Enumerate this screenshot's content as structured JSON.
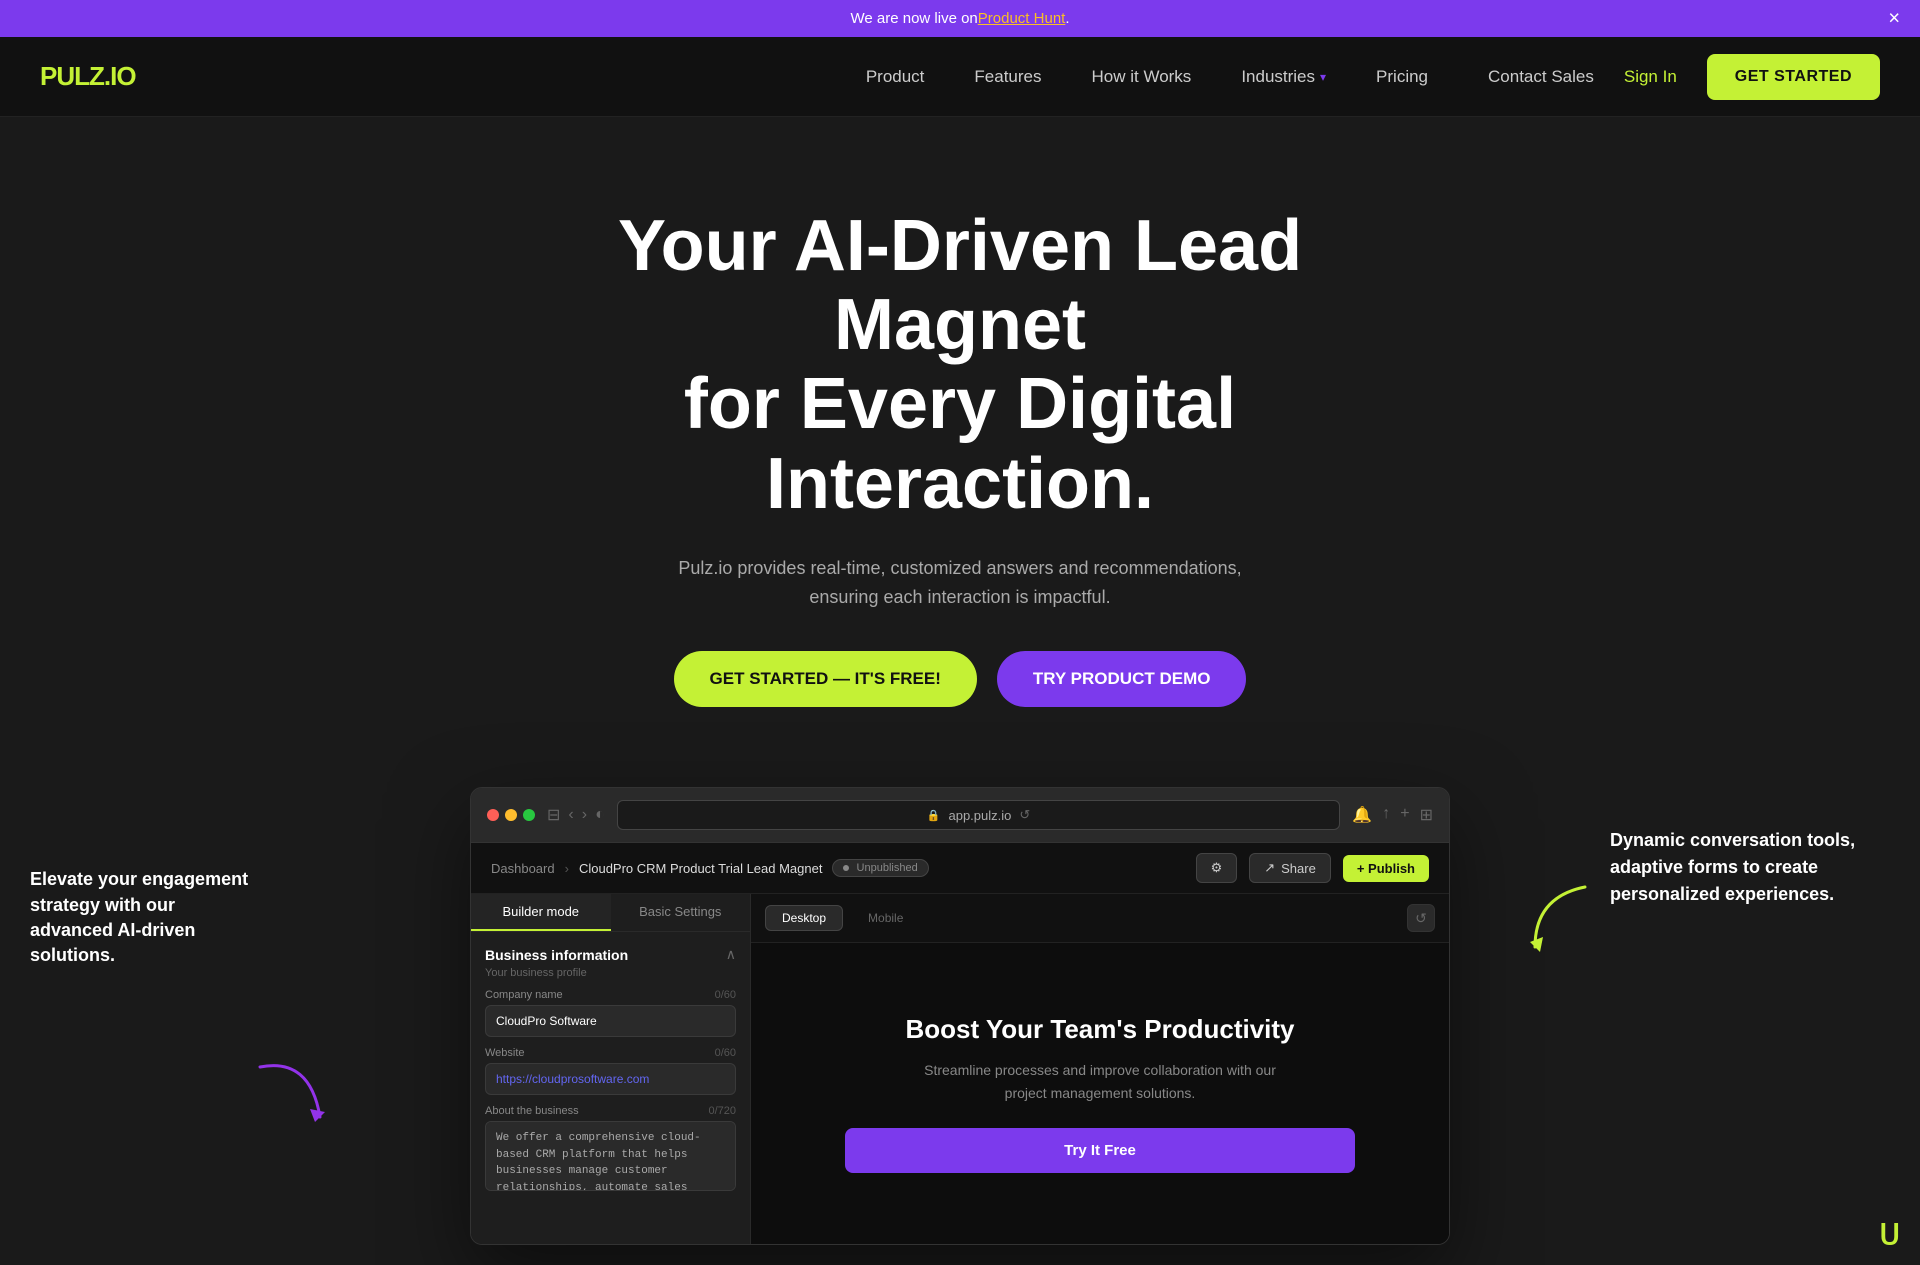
{
  "banner": {
    "text": "We are now live on ",
    "link_text": "Product Hunt",
    "link_url": "#",
    "close_label": "×"
  },
  "navbar": {
    "logo_text": "PULZ",
    "logo_dot": ".",
    "logo_io": "IO",
    "nav_items": [
      {
        "label": "Product",
        "has_dropdown": false
      },
      {
        "label": "Features",
        "has_dropdown": false
      },
      {
        "label": "How it Works",
        "has_dropdown": false
      },
      {
        "label": "Industries",
        "has_dropdown": true
      },
      {
        "label": "Pricing",
        "has_dropdown": false
      }
    ],
    "contact_sales": "Contact Sales",
    "sign_in": "Sign In",
    "get_started": "GET STARTED"
  },
  "hero": {
    "title_line1": "Your AI-Driven Lead Magnet",
    "title_line2": "for Every Digital Interaction.",
    "subtitle": "Pulz.io provides real-time, customized answers and recommendations, ensuring each interaction is impactful.",
    "cta_primary": "GET STARTED — IT'S FREE!",
    "cta_secondary": "TRY PRODUCT DEMO"
  },
  "left_callout": {
    "text": "Elevate your engagement strategy with our advanced AI-driven solutions."
  },
  "right_callout": {
    "text": "Dynamic conversation tools, adaptive forms to create personalized experiences."
  },
  "browser": {
    "address": "app.pulz.io",
    "breadcrumb_home": "Dashboard",
    "breadcrumb_page": "CloudPro CRM Product Trial Lead Magnet",
    "status": "Unpublished",
    "share_label": "Share",
    "publish_label": "+ Publish"
  },
  "left_panel": {
    "tab_builder": "Builder mode",
    "tab_settings": "Basic Settings",
    "section_title": "Business information",
    "section_subtitle": "Your business profile",
    "company_label": "Company name",
    "company_count": "0/60",
    "company_value": "CloudPro Software",
    "website_label": "Website",
    "website_count": "0/60",
    "website_value": "https://cloudprosoftware.com",
    "about_label": "About the business",
    "about_count": "0/720",
    "about_value": "We offer a comprehensive cloud-based CRM platform that helps businesses manage customer relationships, automate sales processes, and analyze customer data for improved decision-making."
  },
  "preview": {
    "desktop_label": "Desktop",
    "mobile_label": "Mobile",
    "title": "Boost Your Team's Productivity",
    "description": "Streamline processes and improve collaboration with our project management solutions.",
    "cta_label": "Try It Free"
  },
  "icons": {
    "close": "×",
    "back": "‹",
    "forward": "›",
    "lock": "🔒",
    "refresh": "↺",
    "download": "↓",
    "share": "↑",
    "add": "+",
    "grid": "⊞",
    "bell": "🔔",
    "info": "ⓘ",
    "collapse": "∧",
    "share_icon": "↗"
  }
}
